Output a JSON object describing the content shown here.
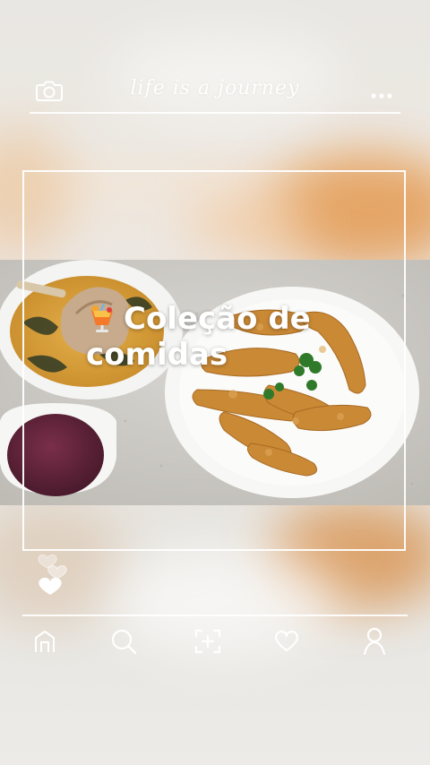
{
  "header": {
    "title": "life is a journey",
    "left_icon": "camera-icon",
    "right_icon": "more-dots-icon"
  },
  "post": {
    "caption_emoji": "tropical-drink-icon",
    "caption_line1": "Coleção de",
    "caption_line2": "comidas"
  },
  "likes": {
    "icons": [
      "heart-outline-icon",
      "heart-outline-icon",
      "heart-filled-icon"
    ]
  },
  "bottom_nav": {
    "items": [
      {
        "name": "home",
        "icon": "home-icon"
      },
      {
        "name": "search",
        "icon": "search-icon"
      },
      {
        "name": "add",
        "icon": "add-square-icon"
      },
      {
        "name": "favorites",
        "icon": "heart-icon"
      },
      {
        "name": "profile",
        "icon": "profile-icon"
      }
    ]
  },
  "colors": {
    "overlay_lines": "#ffffff",
    "background": "#e9e7e3",
    "accent_blur": "#e39a52"
  }
}
